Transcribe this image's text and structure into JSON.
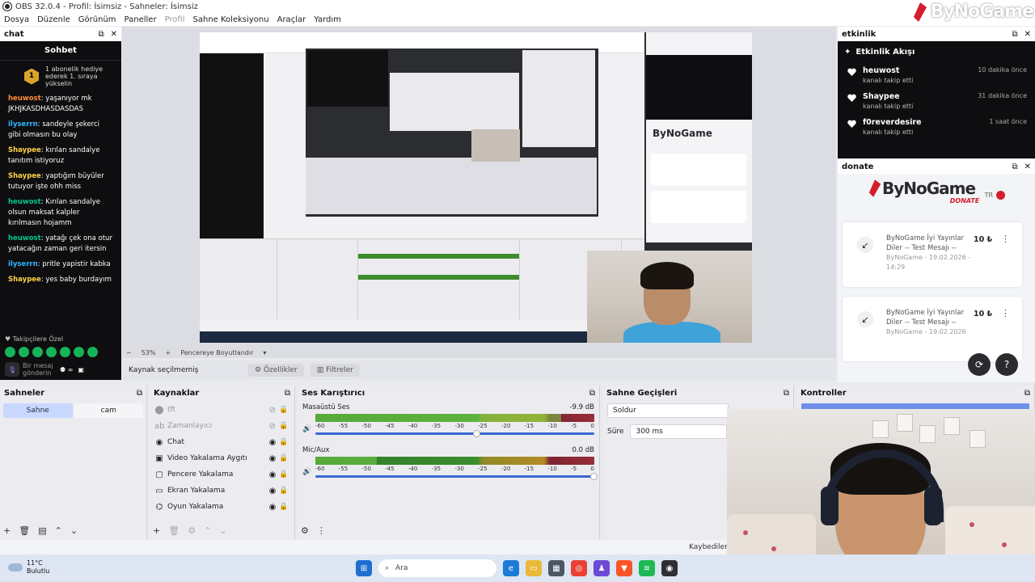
{
  "window": {
    "title": "OBS 32.0.4 - Profil: İsimsiz - Sahneler: İsimsiz"
  },
  "menu": [
    {
      "label": "Dosya",
      "enabled": true
    },
    {
      "label": "Düzenle",
      "enabled": true
    },
    {
      "label": "Görünüm",
      "enabled": true
    },
    {
      "label": "Paneller",
      "enabled": true
    },
    {
      "label": "Profil",
      "enabled": false
    },
    {
      "label": "Sahne Koleksiyonu",
      "enabled": true
    },
    {
      "label": "Araçlar",
      "enabled": true
    },
    {
      "label": "Yardım",
      "enabled": true
    }
  ],
  "brand": {
    "name": "ByNoGame",
    "subtitle": "DONATE",
    "lang": "TR",
    "accent": "#d51d2d"
  },
  "chat": {
    "dock_title": "chat",
    "title": "Sohbet",
    "sub_badge": "1",
    "sub_text": "1 abonelik hediye ederek 1. sıraya yükselin",
    "messages": [
      {
        "user": "heuwost",
        "text": "yaşanıyor mk JKHJKASDHASDASDAS",
        "color": "u1"
      },
      {
        "user": "ilyserrn",
        "text": "sandeyle şekerci gibi olmasın bu olay",
        "color": "u4"
      },
      {
        "user": "Shaypee",
        "text": "kırılan sandalye tanıtım istiyoruz",
        "color": "u2"
      },
      {
        "user": "Shaypee",
        "text": "yaptığım büyüler tutuyor işte ohh miss",
        "color": "u2"
      },
      {
        "user": "heuwost",
        "text": "Kırılan sandalye olsun maksat kalpler kırılmasın hojamm",
        "color": "u3"
      },
      {
        "user": "heuwost",
        "text": "yatağı çek ona otur yatacağın zaman geri itersin",
        "color": "u3"
      },
      {
        "user": "ilyserrn",
        "text": "pritle yapistir kabka",
        "color": "u4"
      },
      {
        "user": "Shaypee",
        "text": "yes baby burdayım",
        "color": "u2"
      }
    ],
    "footer_label": "Takipçilere Özel",
    "input_placeholder": "Bir mesaj gönderin"
  },
  "preview": {
    "zoom": "53%",
    "fit_label": "Pencereye Boyutlandır"
  },
  "events": {
    "dock_title": "etkinlik",
    "title": "Etkinlik Akışı",
    "items": [
      {
        "name": "heuwost",
        "action": "kanalı takip etti",
        "time": "10 dakika önce"
      },
      {
        "name": "Shaypee",
        "action": "kanalı takip etti",
        "time": "31 dakika önce"
      },
      {
        "name": "f0reverdesire",
        "action": "kanalı takip etti",
        "time": "1 saat önce"
      }
    ]
  },
  "donate": {
    "dock_title": "donate",
    "cards": [
      {
        "text": "ByNoGame İyi Yayınlar Diler -- Test Mesajı --",
        "meta": "ByNoGame - 19.02.2026 - 14:29",
        "amount": "10 ₺"
      },
      {
        "text": "ByNoGame İyi Yayınlar Diler -- Test Mesajı --",
        "meta": "ByNoGame - 19.02.2026",
        "amount": "10 ₺"
      }
    ]
  },
  "source_toolbar": {
    "status": "Kaynak seçilmemiş",
    "properties": "Özellikler",
    "filters": "Filtreler"
  },
  "scenes": {
    "title": "Sahneler",
    "items": [
      {
        "label": "Sahne",
        "active": true
      },
      {
        "label": "cam",
        "active": false
      }
    ]
  },
  "sources": {
    "title": "Kaynaklar",
    "items": [
      {
        "label": "tft",
        "icon": "⬤",
        "visible": false
      },
      {
        "label": "Zamanlayıcı",
        "icon": "ab",
        "visible": false
      },
      {
        "label": "Chat",
        "icon": "◉",
        "visible": true
      },
      {
        "label": "Video Yakalama Aygıtı",
        "icon": "▣",
        "visible": true
      },
      {
        "label": "Pencere Yakalama",
        "icon": "▢",
        "visible": true
      },
      {
        "label": "Ekran Yakalama",
        "icon": "▭",
        "visible": true
      },
      {
        "label": "Oyun Yakalama",
        "icon": "⌬",
        "visible": true
      }
    ]
  },
  "mixer": {
    "title": "Ses Karıştırıcı",
    "scale": [
      "-60",
      "-55",
      "-50",
      "-45",
      "-40",
      "-35",
      "-30",
      "-25",
      "-20",
      "-15",
      "-10",
      "-5",
      "0"
    ],
    "channels": [
      {
        "name": "Masaüstü Ses",
        "db": "-9.9 dB",
        "level": 0.88,
        "fader": 0.58
      },
      {
        "name": "Mic/Aux",
        "db": "0.0 dB",
        "level": 0.22,
        "fader": 1.0
      }
    ]
  },
  "transitions": {
    "title": "Sahne Geçişleri",
    "type": "Soldur",
    "duration_label": "Süre",
    "duration": "300 ms"
  },
  "controls": {
    "title": "Kontroller"
  },
  "status": {
    "text": "Kaybedilen"
  },
  "taskbar": {
    "temp": "11°C",
    "weather": "Bulutlu",
    "search": "Ara"
  }
}
